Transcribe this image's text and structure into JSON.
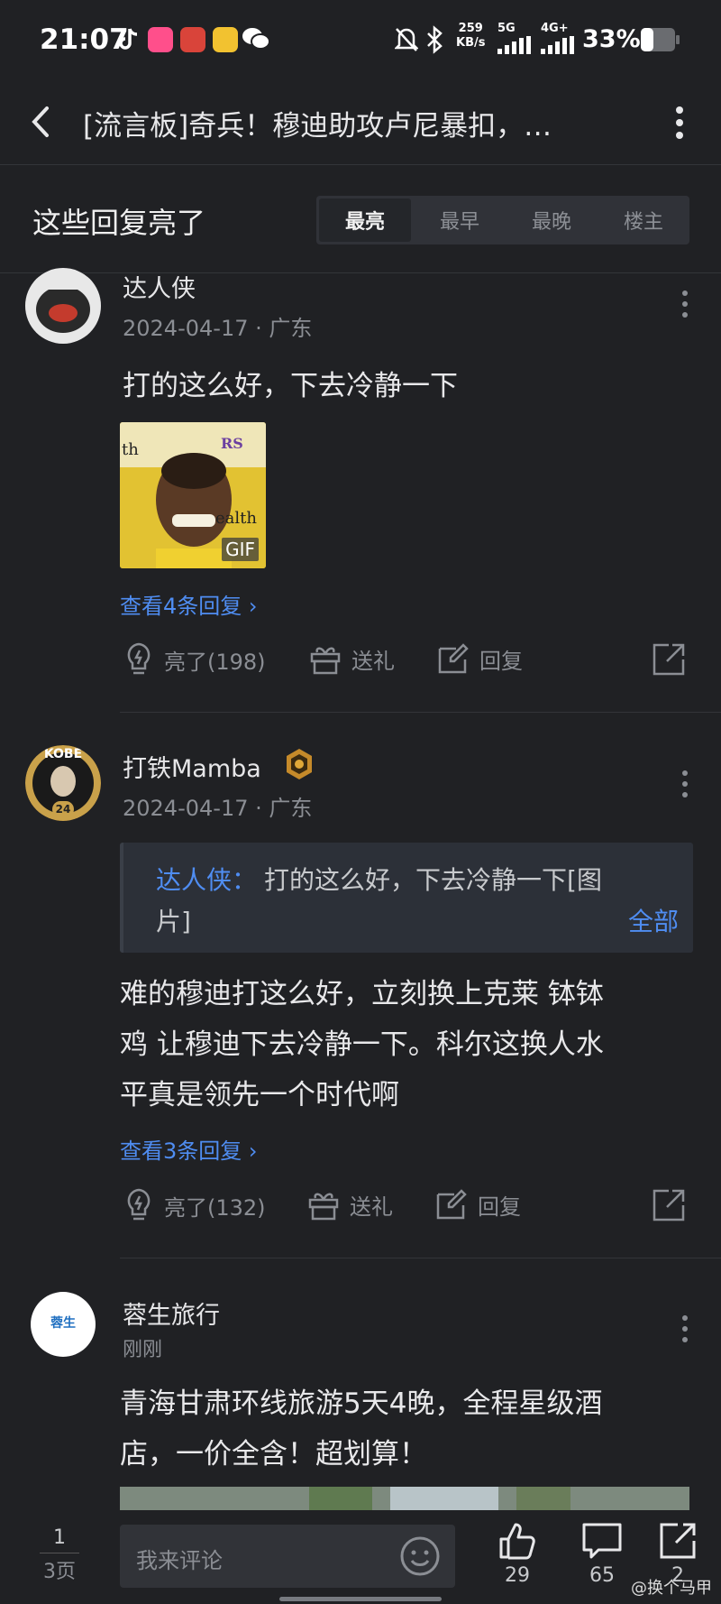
{
  "status_bar": {
    "time": "21:07",
    "net_speed_top": "259",
    "net_speed_bottom": "KB/s",
    "net1": "5G",
    "net2": "4G+",
    "battery": "33%"
  },
  "nav": {
    "title": "[流言板]奇兵！穆迪助攻卢尼暴扣，…"
  },
  "section": {
    "title": "这些回复亮了",
    "tabs": [
      "最亮",
      "最早",
      "最晚",
      "楼主"
    ]
  },
  "comments": [
    {
      "username": "达人侠",
      "meta": "2024-04-17 · 广东",
      "text": "打的这么好，下去冷静一下",
      "gif_label": "GIF",
      "gif_text_a": "th",
      "gif_text_b": "ealth",
      "gif_text_c": "RS",
      "view_replies": "查看4条回复 ›",
      "likes": "亮了(198)",
      "gift": "送礼",
      "reply": "回复"
    },
    {
      "username": "打铁Mamba",
      "avatar_badge": "KOBE",
      "avatar_number": "24",
      "meta": "2024-04-17 · 广东",
      "quote_user": "达人侠：",
      "quote_line1": "打的这么好，下去冷静一下[图",
      "quote_line2": "片]",
      "quote_all": "全部",
      "text_lines": [
        "难的穆迪打这么好，立刻换上克莱 钵钵",
        "鸡 让穆迪下去冷静一下。科尔这换人水",
        "平真是领先一个时代啊"
      ],
      "view_replies": "查看3条回复 ›",
      "likes": "亮了(132)",
      "gift": "送礼",
      "reply": "回复"
    },
    {
      "username": "蓉生旅行",
      "avatar_text": "蓉生",
      "meta": "刚刚",
      "text_lines": [
        "青海甘肃环线旅游5天4晚，全程星级酒",
        "店，一价全含！超划算！"
      ]
    }
  ],
  "bottom_bar": {
    "page_current": "1",
    "page_total": "3页",
    "placeholder": "我来评论",
    "like_count": "29",
    "comment_count": "65",
    "share_count": "2",
    "watermark": "@换个马甲"
  },
  "colors": {
    "background": "#202124",
    "accent": "#4f8df2",
    "muted": "#8b8e94"
  }
}
